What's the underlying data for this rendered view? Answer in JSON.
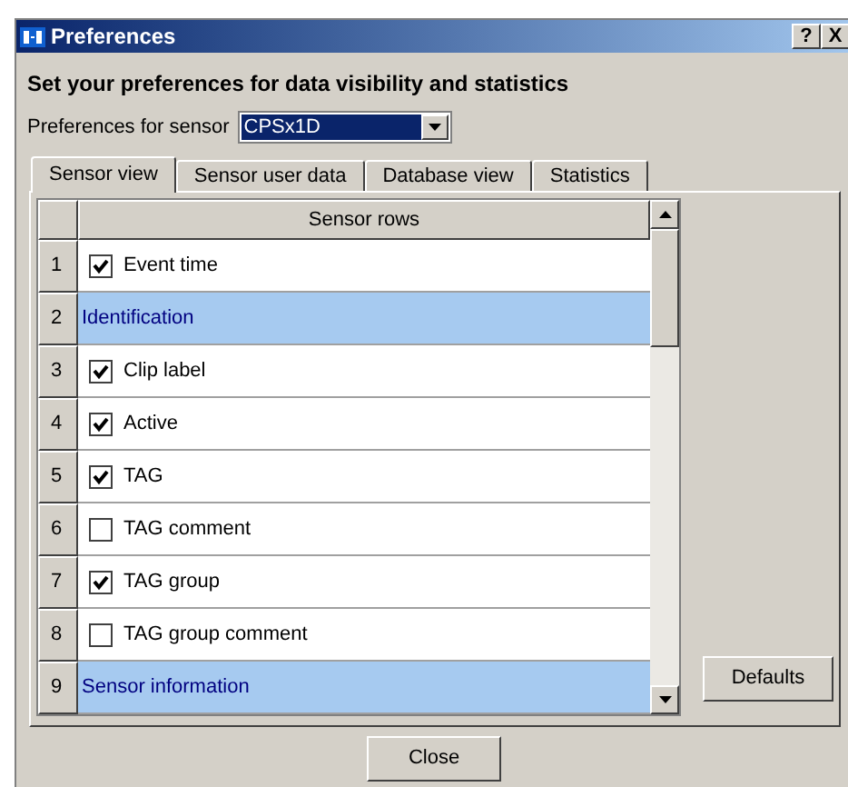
{
  "window": {
    "title": "Preferences",
    "help_button": "?",
    "close_button": "X"
  },
  "heading": "Set your preferences for data visibility and statistics",
  "sensor_select": {
    "label": "Preferences for sensor",
    "value": "CPSx1D"
  },
  "tabs": [
    {
      "label": "Sensor view",
      "selected": true
    },
    {
      "label": "Sensor user data",
      "selected": false
    },
    {
      "label": "Database view",
      "selected": false
    },
    {
      "label": "Statistics",
      "selected": false
    }
  ],
  "table": {
    "column": "Sensor rows",
    "rows": [
      {
        "number": "1",
        "kind": "check",
        "label": "Event time",
        "checked": true
      },
      {
        "number": "2",
        "kind": "section",
        "label": "Identification"
      },
      {
        "number": "3",
        "kind": "check",
        "label": "Clip label",
        "checked": true
      },
      {
        "number": "4",
        "kind": "check",
        "label": "Active",
        "checked": true
      },
      {
        "number": "5",
        "kind": "check",
        "label": "TAG",
        "checked": true
      },
      {
        "number": "6",
        "kind": "check",
        "label": "TAG comment",
        "checked": false
      },
      {
        "number": "7",
        "kind": "check",
        "label": "TAG group",
        "checked": true
      },
      {
        "number": "8",
        "kind": "check",
        "label": "TAG group comment",
        "checked": false
      },
      {
        "number": "9",
        "kind": "section",
        "label": "Sensor information"
      }
    ]
  },
  "defaults_button": "Defaults",
  "close_button": "Close"
}
